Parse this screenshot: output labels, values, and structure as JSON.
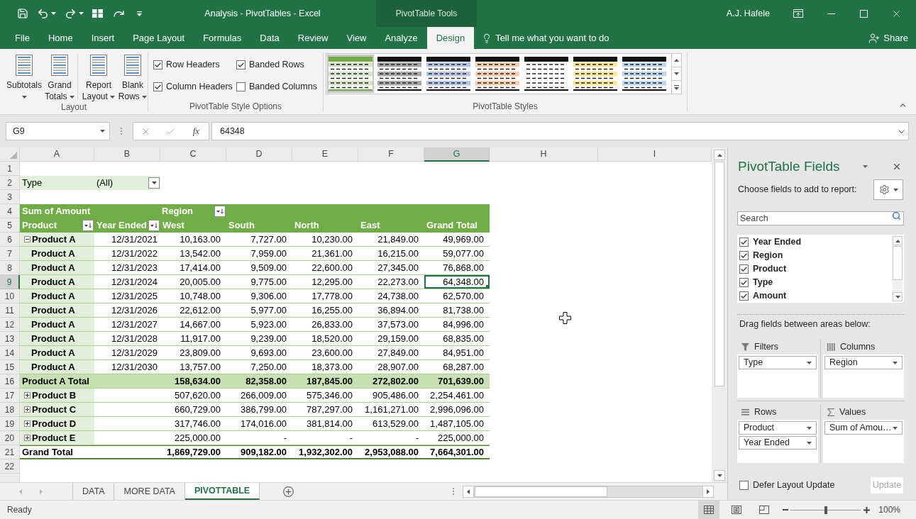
{
  "window": {
    "title": "Analysis - PivotTables - Excel",
    "tool_group": "PivotTable Tools",
    "user": "A.J. Hafele"
  },
  "ribbon_tabs": [
    {
      "label": "File",
      "selected": false
    },
    {
      "label": "Home",
      "selected": false
    },
    {
      "label": "Insert",
      "selected": false
    },
    {
      "label": "Page Layout",
      "selected": false
    },
    {
      "label": "Formulas",
      "selected": false
    },
    {
      "label": "Data",
      "selected": false
    },
    {
      "label": "Review",
      "selected": false
    },
    {
      "label": "View",
      "selected": false
    },
    {
      "label": "Analyze",
      "selected": false
    },
    {
      "label": "Design",
      "selected": true
    }
  ],
  "tell_me": {
    "placeholder": "Tell me what you want to do"
  },
  "share": {
    "label": "Share"
  },
  "ribbon": {
    "layout": {
      "label": "Layout",
      "buttons": [
        {
          "label": "Subtotals"
        },
        {
          "label": "Grand Totals"
        },
        {
          "label": "Report Layout"
        },
        {
          "label": "Blank Rows"
        }
      ]
    },
    "style_options": {
      "label": "PivotTable Style Options",
      "options": [
        {
          "label": "Row Headers",
          "checked": true
        },
        {
          "label": "Banded Rows",
          "checked": true
        },
        {
          "label": "Column Headers",
          "checked": true
        },
        {
          "label": "Banded Columns",
          "checked": false
        }
      ]
    },
    "styles": {
      "label": "PivotTable Styles",
      "items": [
        {
          "kind": "accent",
          "color": "#70ad47",
          "selected": true
        },
        {
          "kind": "dark",
          "color": "#a6a6a6",
          "selected": false
        },
        {
          "kind": "dark",
          "color": "#b4c6e7",
          "selected": false
        },
        {
          "kind": "dark",
          "color": "#f8cbad",
          "selected": false
        },
        {
          "kind": "dark",
          "selected": false
        },
        {
          "kind": "dark",
          "color": "#ffe699",
          "selected": false
        },
        {
          "kind": "dark",
          "color": "#bdd7ee",
          "selected": false
        }
      ]
    }
  },
  "formula_bar": {
    "name_box": "G9",
    "function_label": "fx",
    "formula": "64348"
  },
  "sheet": {
    "columns": [
      {
        "label": "A",
        "selected": false
      },
      {
        "label": "B",
        "selected": false
      },
      {
        "label": "C",
        "selected": false
      },
      {
        "label": "D",
        "selected": false
      },
      {
        "label": "E",
        "selected": false
      },
      {
        "label": "F",
        "selected": false
      },
      {
        "label": "G",
        "selected": true
      },
      {
        "label": "H",
        "selected": false
      },
      {
        "label": "I",
        "selected": false
      }
    ],
    "rows": [
      {
        "number": "1",
        "selected": false,
        "kind": "blank"
      },
      {
        "number": "2",
        "selected": false,
        "kind": "report_filter",
        "field": "Type",
        "value": "(All)"
      },
      {
        "number": "3",
        "selected": false,
        "kind": "blank"
      },
      {
        "number": "4",
        "selected": false,
        "kind": "pivot_title",
        "value_label": "Sum of Amount",
        "column_field": {
          "label": "Region",
          "filter": true
        }
      },
      {
        "number": "5",
        "selected": false,
        "kind": "pivot_fields",
        "labels": [
          {
            "label": "Product",
            "filter": true
          },
          {
            "label": "Year Ended",
            "filter": true
          },
          {
            "label": "West",
            "filter": false
          },
          {
            "label": "South",
            "filter": false
          },
          {
            "label": "North",
            "filter": false
          },
          {
            "label": "East",
            "filter": false
          },
          {
            "label": "Grand Total",
            "filter": false
          }
        ]
      },
      {
        "number": "6",
        "selected": false,
        "kind": "item",
        "expanded": true,
        "label": "Product A",
        "year": "12/31/2021",
        "values": [
          "10,163.00",
          "7,727.00",
          "10,230.00",
          "21,849.00",
          "49,969.00"
        ]
      },
      {
        "number": "7",
        "selected": false,
        "kind": "item",
        "label": "Product A",
        "year": "12/31/2022",
        "values": [
          "13,542.00",
          "7,959.00",
          "21,361.00",
          "16,215.00",
          "59,077.00"
        ]
      },
      {
        "number": "8",
        "selected": false,
        "kind": "item",
        "label": "Product A",
        "year": "12/31/2023",
        "values": [
          "17,414.00",
          "9,509.00",
          "22,600.00",
          "27,345.00",
          "76,868.00"
        ]
      },
      {
        "number": "9",
        "selected": true,
        "kind": "item",
        "label": "Product A",
        "year": "12/31/2024",
        "values": [
          "20,005.00",
          "9,775.00",
          "12,295.00",
          "22,273.00",
          "64,348.00"
        ]
      },
      {
        "number": "10",
        "selected": false,
        "kind": "item",
        "label": "Product A",
        "year": "12/31/2025",
        "values": [
          "10,748.00",
          "9,306.00",
          "17,778.00",
          "24,738.00",
          "62,570.00"
        ]
      },
      {
        "number": "11",
        "selected": false,
        "kind": "item",
        "label": "Product A",
        "year": "12/31/2026",
        "values": [
          "22,612.00",
          "5,977.00",
          "16,255.00",
          "36,894.00",
          "81,738.00"
        ]
      },
      {
        "number": "12",
        "selected": false,
        "kind": "item",
        "label": "Product A",
        "year": "12/31/2027",
        "values": [
          "14,667.00",
          "5,923.00",
          "26,833.00",
          "37,573.00",
          "84,996.00"
        ]
      },
      {
        "number": "13",
        "selected": false,
        "kind": "item",
        "label": "Product A",
        "year": "12/31/2028",
        "values": [
          "11,917.00",
          "9,239.00",
          "18,520.00",
          "29,159.00",
          "68,835.00"
        ]
      },
      {
        "number": "14",
        "selected": false,
        "kind": "item",
        "label": "Product A",
        "year": "12/31/2029",
        "values": [
          "23,809.00",
          "9,693.00",
          "23,600.00",
          "27,849.00",
          "84,951.00"
        ]
      },
      {
        "number": "15",
        "selected": false,
        "kind": "item",
        "label": "Product A",
        "year": "12/31/2030",
        "values": [
          "13,757.00",
          "7,250.00",
          "18,373.00",
          "28,907.00",
          "68,287.00"
        ]
      },
      {
        "number": "16",
        "selected": false,
        "kind": "subtotal",
        "label": "Product A Total",
        "values": [
          "158,634.00",
          "82,358.00",
          "187,845.00",
          "272,802.00",
          "701,639.00"
        ]
      },
      {
        "number": "17",
        "selected": false,
        "kind": "item",
        "expanded": false,
        "label": "Product B",
        "values": [
          "507,620.00",
          "266,009.00",
          "575,346.00",
          "905,486.00",
          "2,254,461.00"
        ]
      },
      {
        "number": "18",
        "selected": false,
        "kind": "item",
        "expanded": false,
        "label": "Product C",
        "values": [
          "660,729.00",
          "386,799.00",
          "787,297.00",
          "1,161,271.00",
          "2,996,096.00"
        ]
      },
      {
        "number": "19",
        "selected": false,
        "kind": "item",
        "expanded": false,
        "label": "Product D",
        "values": [
          "317,746.00",
          "174,016.00",
          "381,814.00",
          "613,529.00",
          "1,487,105.00"
        ]
      },
      {
        "number": "20",
        "selected": false,
        "kind": "item",
        "expanded": false,
        "label": "Product E",
        "values": [
          "225,000.00",
          "-",
          "-",
          "-",
          "225,000.00"
        ]
      },
      {
        "number": "21",
        "selected": false,
        "kind": "grand_total",
        "label": "Grand Total",
        "values": [
          "1,869,729.00",
          "909,182.00",
          "1,932,302.00",
          "2,953,088.00",
          "7,664,301.00"
        ]
      },
      {
        "number": "22",
        "selected": false,
        "kind": "blank"
      }
    ]
  },
  "sheet_tabs": [
    {
      "label": "DATA",
      "selected": false
    },
    {
      "label": "MORE DATA",
      "selected": false
    },
    {
      "label": "PIVOTTABLE",
      "selected": true
    }
  ],
  "field_list": {
    "title": "PivotTable Fields",
    "prompt": "Choose fields to add to report:",
    "search": {
      "placeholder": "Search"
    },
    "fields": [
      {
        "label": "Year Ended",
        "checked": true
      },
      {
        "label": "Region",
        "checked": true
      },
      {
        "label": "Product",
        "checked": true
      },
      {
        "label": "Type",
        "checked": true
      },
      {
        "label": "Amount",
        "checked": true
      }
    ],
    "areas_prompt": "Drag fields between areas below:",
    "areas": [
      {
        "kind": "filters",
        "label": "Filters",
        "fields": [
          "Type"
        ]
      },
      {
        "kind": "columns",
        "label": "Columns",
        "fields": [
          "Region"
        ]
      },
      {
        "kind": "rows",
        "label": "Rows",
        "fields": [
          "Product",
          "Year Ended"
        ]
      },
      {
        "kind": "values",
        "label": "Values",
        "fields": [
          "Sum of Amou…"
        ]
      }
    ],
    "defer": {
      "label": "Defer Layout Update",
      "checked": false
    },
    "update": {
      "label": "Update",
      "disabled": true
    }
  },
  "status_bar": {
    "status": "Ready",
    "views": [
      {
        "kind": "normal",
        "selected": true
      },
      {
        "kind": "page_layout",
        "selected": false
      },
      {
        "kind": "page_break",
        "selected": false
      }
    ],
    "zoom": {
      "level": 0.5,
      "reading": "100%"
    }
  }
}
